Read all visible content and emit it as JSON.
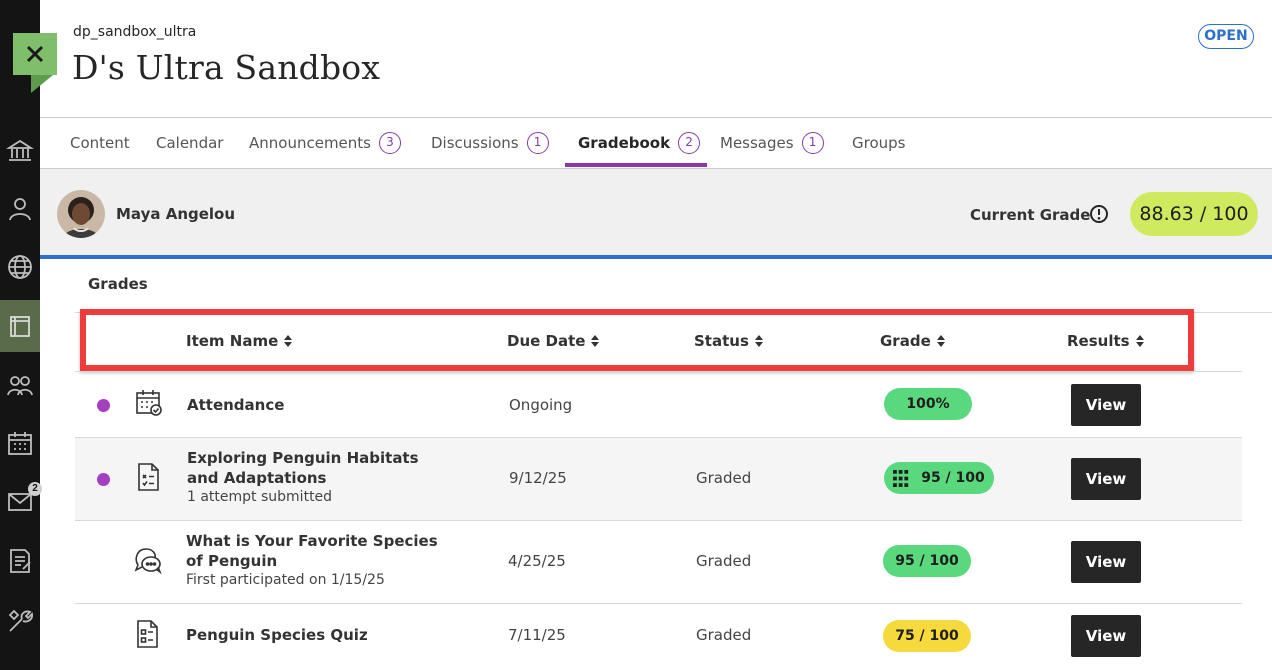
{
  "course": {
    "id": "dp_sandbox_ultra",
    "title": "D's Ultra Sandbox",
    "status": "OPEN"
  },
  "close_icon": "close-x-icon",
  "nav_rail": {
    "icons": [
      "institution-icon",
      "profile-icon",
      "globe-icon",
      "courses-icon",
      "groups-icon",
      "calendar-icon",
      "messages-icon",
      "grades-icon",
      "tools-icon"
    ],
    "messages_badge": "2"
  },
  "tabs": [
    {
      "label": "Content",
      "count": ""
    },
    {
      "label": "Calendar",
      "count": ""
    },
    {
      "label": "Announcements",
      "count": "3"
    },
    {
      "label": "Discussions",
      "count": "1"
    },
    {
      "label": "Gradebook",
      "count": "2"
    },
    {
      "label": "Messages",
      "count": "1"
    },
    {
      "label": "Groups",
      "count": ""
    }
  ],
  "active_tab": "Gradebook",
  "student": {
    "name": "Maya Angelou",
    "current_grade_label": "Current Grade",
    "current_grade": "88.63 / 100"
  },
  "grades": {
    "section_label": "Grades",
    "columns": [
      "Item Name",
      "Due Date",
      "Status",
      "Grade",
      "Results"
    ],
    "rows": [
      {
        "title": "Attendance",
        "subtitle": "",
        "due": "Ongoing",
        "status": "",
        "grade": "100%",
        "grade_color": "green",
        "icon": "attendance-calendar-icon",
        "new": true,
        "rubric": false,
        "action": "View"
      },
      {
        "title": "Exploring Penguin Habitats and Adaptations",
        "subtitle": "1 attempt submitted",
        "due": "9/12/25",
        "status": "Graded",
        "grade": "95 / 100",
        "grade_color": "green",
        "icon": "assignment-icon",
        "new": true,
        "rubric": true,
        "action": "View"
      },
      {
        "title": "What is Your Favorite Species of Penguin",
        "subtitle": "First participated on 1/15/25",
        "due": "4/25/25",
        "status": "Graded",
        "grade": "95 / 100",
        "grade_color": "green",
        "icon": "discussion-icon",
        "new": false,
        "rubric": false,
        "action": "View"
      },
      {
        "title": "Penguin Species Quiz",
        "subtitle": "",
        "due": "7/11/25",
        "status": "Graded",
        "grade": "75 / 100",
        "grade_color": "yellow",
        "icon": "quiz-icon",
        "new": false,
        "rubric": false,
        "action": "View"
      }
    ]
  },
  "colors": {
    "accent_purple": "#8a3aa8",
    "brand_blue": "#2c6fd1",
    "grade_green": "#5ad87d",
    "grade_yellow": "#f6d93c",
    "current_grade_bg": "#cfea5f",
    "highlight_red": "#ee3b3b"
  }
}
